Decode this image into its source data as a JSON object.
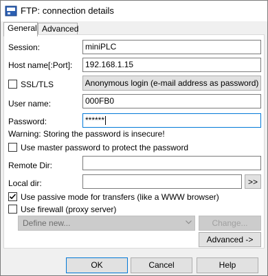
{
  "window": {
    "title": "FTP: connection details"
  },
  "tabs": [
    {
      "label": "General"
    },
    {
      "label": "Advanced"
    }
  ],
  "form": {
    "session_label": "Session:",
    "session_value": "miniPLC",
    "host_label": "Host name[:Port]:",
    "host_value": "192.168.1.15",
    "ssl_label": "SSL/TLS",
    "anon_button": "Anonymous login (e-mail address as password)",
    "user_label": "User name:",
    "user_value": "000FB0",
    "password_label": "Password:",
    "password_value": "******",
    "warning": "Warning: Storing the password is insecure!",
    "master_password_label": "Use master password to protect the password",
    "remote_dir_label": "Remote Dir:",
    "remote_dir_value": "",
    "local_dir_label": "Local dir:",
    "local_dir_value": "",
    "browse_button": ">>",
    "passive_label": "Use passive mode for transfers (like a WWW browser)",
    "passive_checked": true,
    "firewall_label": "Use firewall (proxy server)",
    "firewall_checked": false,
    "define_new_value": "Define new...",
    "change_button": "Change...",
    "advanced_button": "Advanced ->"
  },
  "footer": {
    "ok": "OK",
    "cancel": "Cancel",
    "help": "Help"
  },
  "colors": {
    "focus": "#0078d7",
    "disabled": "#cccccc"
  }
}
